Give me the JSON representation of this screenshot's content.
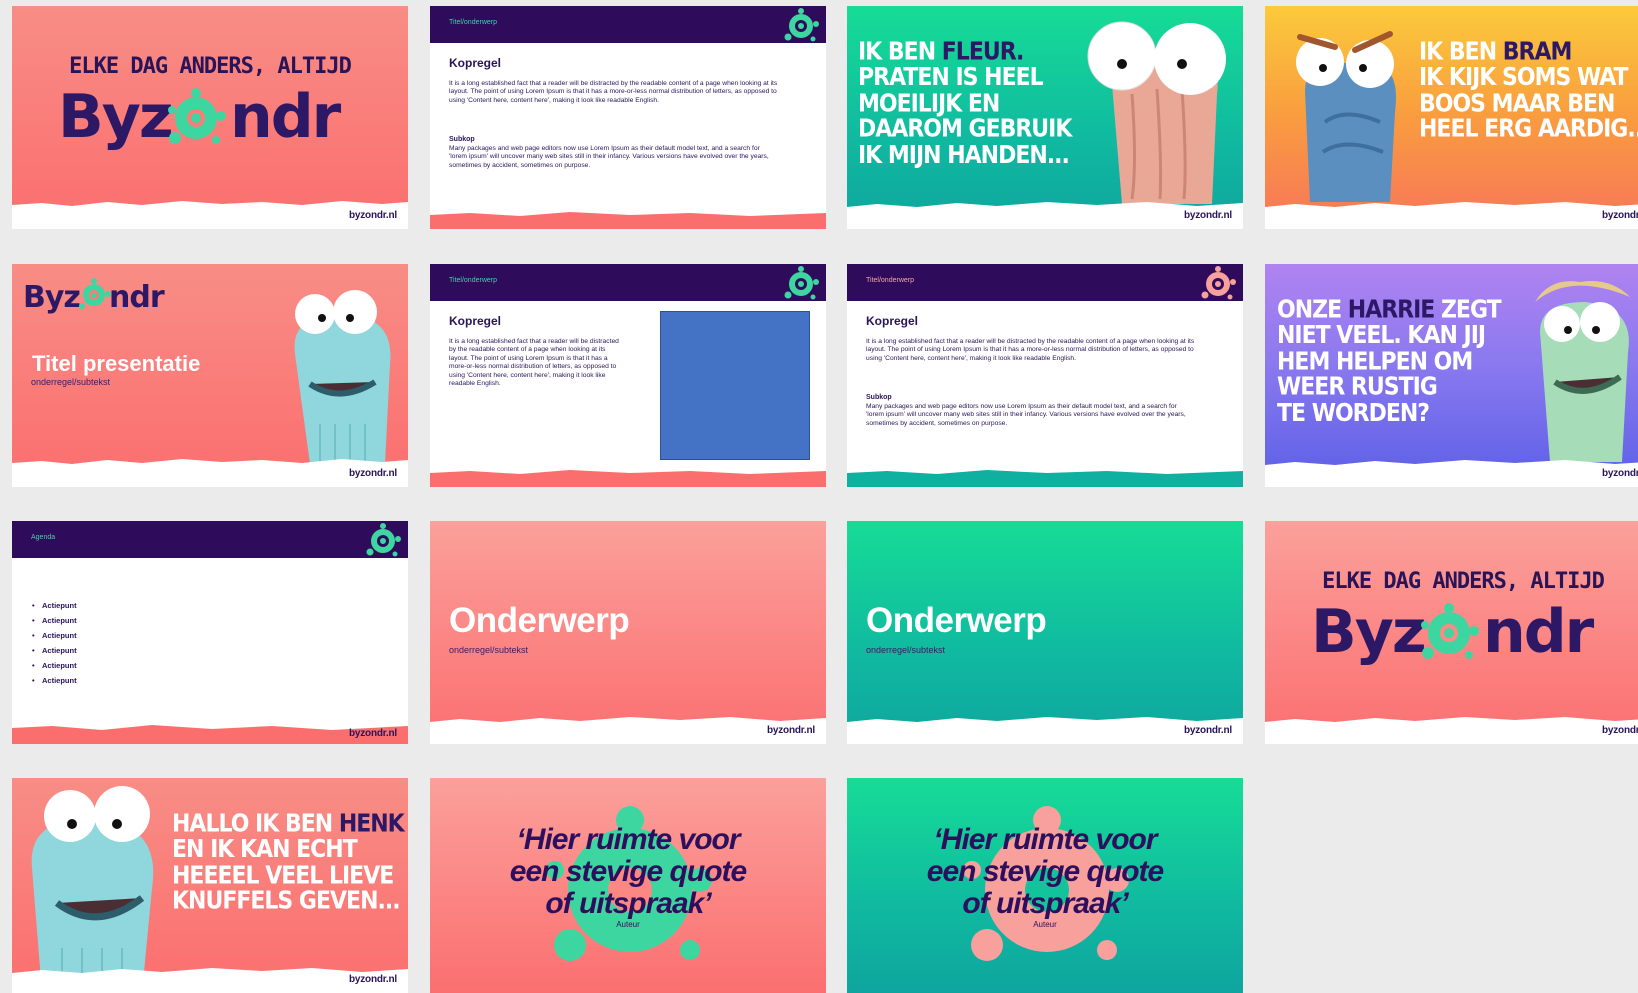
{
  "footer_url": "byzondr.nl",
  "brand": {
    "tagline": "ELKE DAG ANDERS, ALTIJD",
    "logo_left": "Byz",
    "logo_right": "ndr",
    "colors": {
      "purple": "#2d1866",
      "green": "#3ed6a0",
      "coral": "#fb6e6e",
      "teal": "#10b9a0"
    }
  },
  "slides": {
    "s1": {
      "type": "title-logo"
    },
    "s2": {
      "bar_label": "Titel/onderwerp",
      "heading": "Kopregel",
      "body": "It is a long established fact that a reader will be distracted by the readable content of a page when looking at its layout. The point of using Lorem Ipsum is that it has a more-or-less normal distribution of letters, as opposed to using 'Content here, content here', making it look like readable English.",
      "subhead": "Subkop",
      "sub_body": "Many packages and web page editors now use Lorem Ipsum as their default model text, and a search for 'lorem ipsum' will uncover many web sites still in their infancy. Various versions have evolved over the years, sometimes by accident, sometimes on purpose."
    },
    "s3": {
      "lines": [
        "IK BEN ",
        "PRATEN IS HEEL",
        "MOEILIJK EN",
        "DAAROM GEBRUIK",
        "IK MIJN HANDEN..."
      ],
      "name": "FLEUR."
    },
    "s4": {
      "lines": [
        "IK BEN ",
        "IK KIJK SOMS WAT",
        "BOOS MAAR BEN",
        "HEEL ERG AARDIG..."
      ],
      "name": "BRAM"
    },
    "s5": {
      "title": "Titel presentatie",
      "subtitle": "onderregel/subtekst"
    },
    "s6": {
      "bar_label": "Titel/onderwerp",
      "heading": "Kopregel",
      "body": "It is a long established fact that a reader will be distracted by the readable content of a page when looking at its layout. The point of using Lorem Ipsum is that it has a more-or-less normal distribution of letters, as opposed to using 'Content here, content here', making it look like readable English."
    },
    "s7": {
      "bar_label": "Titel/onderwerp",
      "heading": "Kopregel",
      "body": "It is a long established fact that a reader will be distracted by the readable content of a page when looking at its layout. The point of using Lorem Ipsum is that it has a more-or-less normal distribution of letters, as opposed to using 'Content here, content here', making it look like readable English.",
      "subhead": "Subkop",
      "sub_body": "Many packages and web page editors now use Lorem Ipsum as their default model text, and a search for 'lorem ipsum' will uncover many web sites still in their infancy. Various versions have evolved over the years, sometimes by accident, sometimes on purpose."
    },
    "s8": {
      "lines": [
        "ONZE ",
        "NIET VEEL. KAN JIJ",
        "HEM HELPEN OM",
        "WEER RUSTIG",
        "TE WORDEN?"
      ],
      "name": "HARRIE",
      "after": " ZEGT"
    },
    "s9": {
      "bar_label": "Agenda",
      "items": [
        "Actiepunt",
        "Actiepunt",
        "Actiepunt",
        "Actiepunt",
        "Actiepunt",
        "Actiepunt"
      ]
    },
    "s10": {
      "title": "Onderwerp",
      "subtitle": "onderregel/subtekst"
    },
    "s11": {
      "title": "Onderwerp",
      "subtitle": "onderregel/subtekst"
    },
    "s12": {
      "type": "title-logo"
    },
    "s13": {
      "lines": [
        "HALLO IK BEN ",
        "EN IK KAN ECHT",
        "HEEEEL VEEL LIEVE",
        "KNUFFELS GEVEN..."
      ],
      "name": "HENK"
    },
    "s14": {
      "quote_l1": "‘Hier ruimte voor",
      "quote_l2": "een stevige quote",
      "quote_l3": "of uitspraak’",
      "author": "Auteur"
    },
    "s15": {
      "quote_l1": "‘Hier ruimte voor",
      "quote_l2": "een stevige quote",
      "quote_l3": "of uitspraak’",
      "author": "Auteur"
    }
  }
}
